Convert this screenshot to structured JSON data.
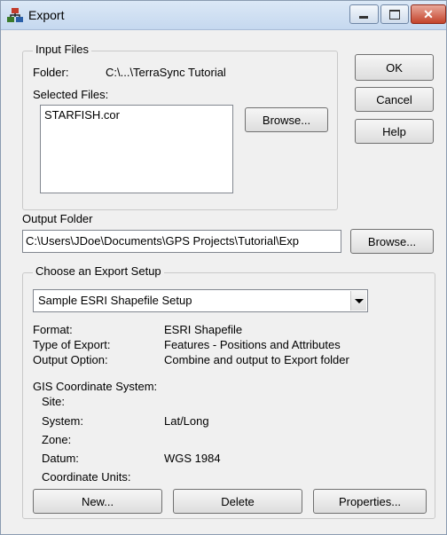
{
  "window": {
    "title": "Export"
  },
  "input_files": {
    "legend": "Input Files",
    "folder_label": "Folder:",
    "folder_value": "C:\\...\\TerraSync Tutorial",
    "selected_label": "Selected Files:",
    "files": [
      "STARFISH.cor"
    ],
    "browse_label": "Browse..."
  },
  "side_buttons": {
    "ok": "OK",
    "cancel": "Cancel",
    "help": "Help"
  },
  "output_folder": {
    "label": "Output Folder",
    "value": "C:\\Users\\JDoe\\Documents\\GPS Projects\\Tutorial\\Exp",
    "browse_label": "Browse..."
  },
  "export_setup": {
    "legend": "Choose an Export Setup",
    "selected": "Sample ESRI Shapefile Setup",
    "format_label": "Format:",
    "format_value": "ESRI Shapefile",
    "type_label": "Type of Export:",
    "type_value": "Features - Positions and Attributes",
    "output_label": "Output Option:",
    "output_value": "Combine and output to Export folder",
    "gis_label": "GIS Coordinate System:",
    "site_label": "Site:",
    "site_value": "",
    "system_label": "System:",
    "system_value": "Lat/Long",
    "zone_label": "Zone:",
    "zone_value": "",
    "datum_label": "Datum:",
    "datum_value": "WGS 1984",
    "units_label": "Coordinate Units:",
    "units_value": "",
    "new_label": "New...",
    "delete_label": "Delete",
    "properties_label": "Properties..."
  }
}
